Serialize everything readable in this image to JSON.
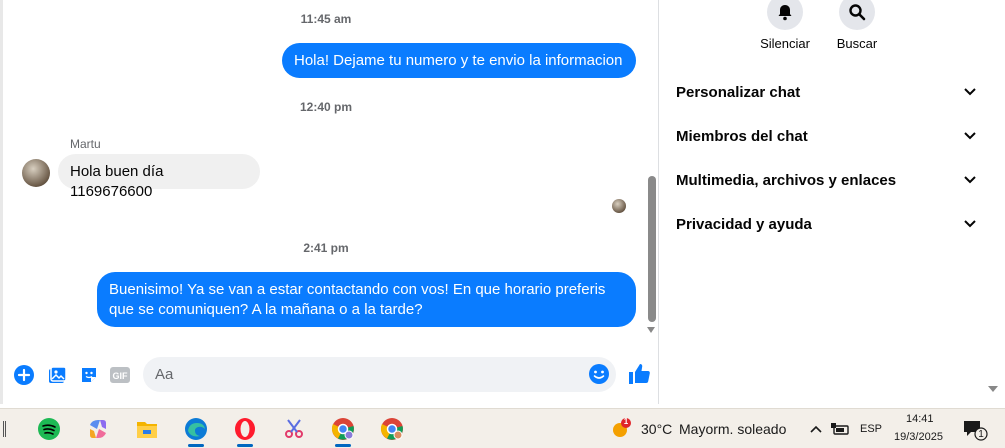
{
  "chat": {
    "timestamps": [
      "11:45 am",
      "12:40 pm",
      "2:41 pm"
    ],
    "messages": [
      {
        "text": "Hola! Dejame tu numero y te envio la informacion"
      },
      {
        "sender": "Martu",
        "text": "Hola buen día 1169676600"
      },
      {
        "text_line1": "Buenisimo! Ya se van a estar contactando con vos! En que horario preferis",
        "text_line2": "que se comuniquen? A la mañana o a la tarde?"
      }
    ],
    "composer": {
      "placeholder": "Aa"
    }
  },
  "panel": {
    "actions": [
      {
        "label": "Silenciar",
        "icon": "bell-icon"
      },
      {
        "label": "Buscar",
        "icon": "search-icon"
      }
    ],
    "sections": [
      {
        "label": "Personalizar chat"
      },
      {
        "label": "Miembros del chat"
      },
      {
        "label": "Multimedia, archivos y enlaces"
      },
      {
        "label": "Privacidad y ayuda"
      }
    ]
  },
  "taskbar": {
    "apps": [
      "spotify-icon",
      "copilot-icon",
      "file-explorer-icon",
      "edge-icon",
      "opera-icon",
      "snipping-tool-icon",
      "chrome-profile-icon",
      "chrome-icon"
    ],
    "weather": {
      "badge": "1",
      "temp": "30°C",
      "condition": "Mayorm. soleado"
    },
    "lang": "ESP",
    "time": "14:41",
    "date": "19/3/2025",
    "notifications": "1"
  },
  "colors": {
    "messenger_blue": "#0a7cff",
    "bubble_gray": "#f0f0f0"
  }
}
